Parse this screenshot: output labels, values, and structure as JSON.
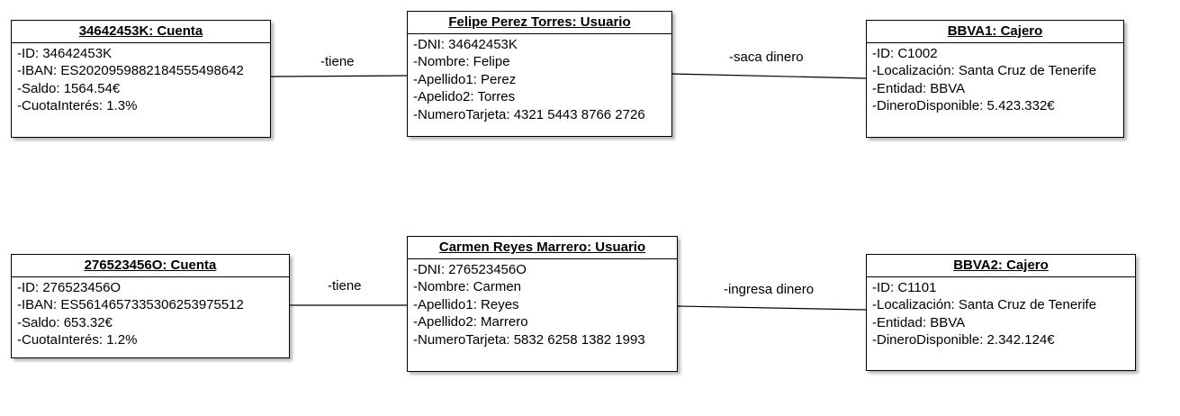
{
  "objects": {
    "cuenta1": {
      "title": "34642453K: Cuenta",
      "attrs": [
        "-ID: 34642453K",
        "-IBAN: ES2020959882184555498642",
        "-Saldo: 1564.54€",
        "-CuotaInterés: 1.3%"
      ]
    },
    "usuario1": {
      "title": "Felipe Perez Torres: Usuario",
      "attrs": [
        "-DNI: 34642453K",
        "-Nombre: Felipe",
        "-Apellido1: Perez",
        "-Apelido2: Torres",
        "-NumeroTarjeta: 4321 5443 8766 2726"
      ]
    },
    "cajero1": {
      "title": "BBVA1: Cajero",
      "attrs": [
        "-ID: C1002",
        "-Localización: Santa Cruz de Tenerife",
        "-Entidad: BBVA",
        "-DineroDisponible: 5.423.332€"
      ]
    },
    "cuenta2": {
      "title": "276523456O: Cuenta",
      "attrs": [
        "-ID: 276523456O",
        "-IBAN: ES5614657335306253975512",
        "-Saldo: 653.32€",
        "-CuotaInterés: 1.2%"
      ]
    },
    "usuario2": {
      "title": "Carmen Reyes Marrero: Usuario",
      "attrs": [
        "-DNI: 276523456O",
        "-Nombre: Carmen",
        "-Apellido1: Reyes",
        "-Apellido2: Marrero",
        "-NumeroTarjeta: 5832 6258 1382 1993"
      ]
    },
    "cajero2": {
      "title": "BBVA2: Cajero",
      "attrs": [
        "-ID: C1101",
        "-Localización: Santa Cruz de Tenerife",
        "-Entidad: BBVA",
        "-DineroDisponible: 2.342.124€"
      ]
    }
  },
  "links": {
    "tiene1": "-tiene",
    "saca": "-saca dinero",
    "tiene2": "-tiene",
    "ingresa": "-ingresa dinero"
  }
}
